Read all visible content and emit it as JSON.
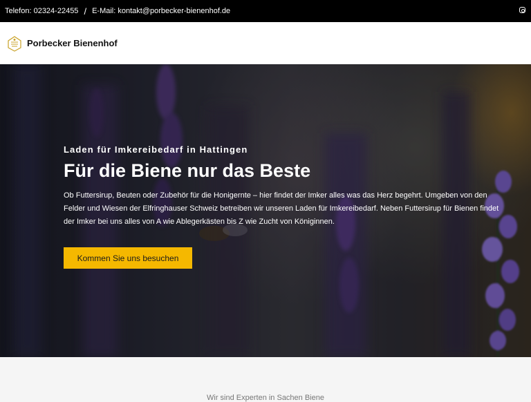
{
  "topbar": {
    "phone": "Telefon: 02324-22455",
    "separator": "/",
    "email": "E-Mail: kontakt@porbecker-bienenhof.de",
    "social_icon": "instagram-icon"
  },
  "header": {
    "brand": "Porbecker Bienenhof",
    "logo_icon": "bee-logo-icon"
  },
  "hero": {
    "subtitle": "Laden für Imkereibedarf in Hattingen",
    "title": "Für die Biene nur das Beste",
    "text": "Ob Futtersirup, Beuten oder Zubehör für die Honigernte – hier findet der Imker alles was das Herz begehrt. Umgeben von den Felder und Wiesen der Elfringhauser Schweiz betreiben wir unseren Laden für Imkereibedarf. Neben Futtersirup für Bienen findet der Imker bei uns alles von A wie Ablegerkästen bis Z wie Zucht von Königinnen.",
    "button_label": "Kommen Sie uns besuchen"
  },
  "section": {
    "intro": "Wir sind Experten in Sachen Biene"
  },
  "colors": {
    "accent": "#f5b800",
    "topbar_bg": "#000000"
  }
}
